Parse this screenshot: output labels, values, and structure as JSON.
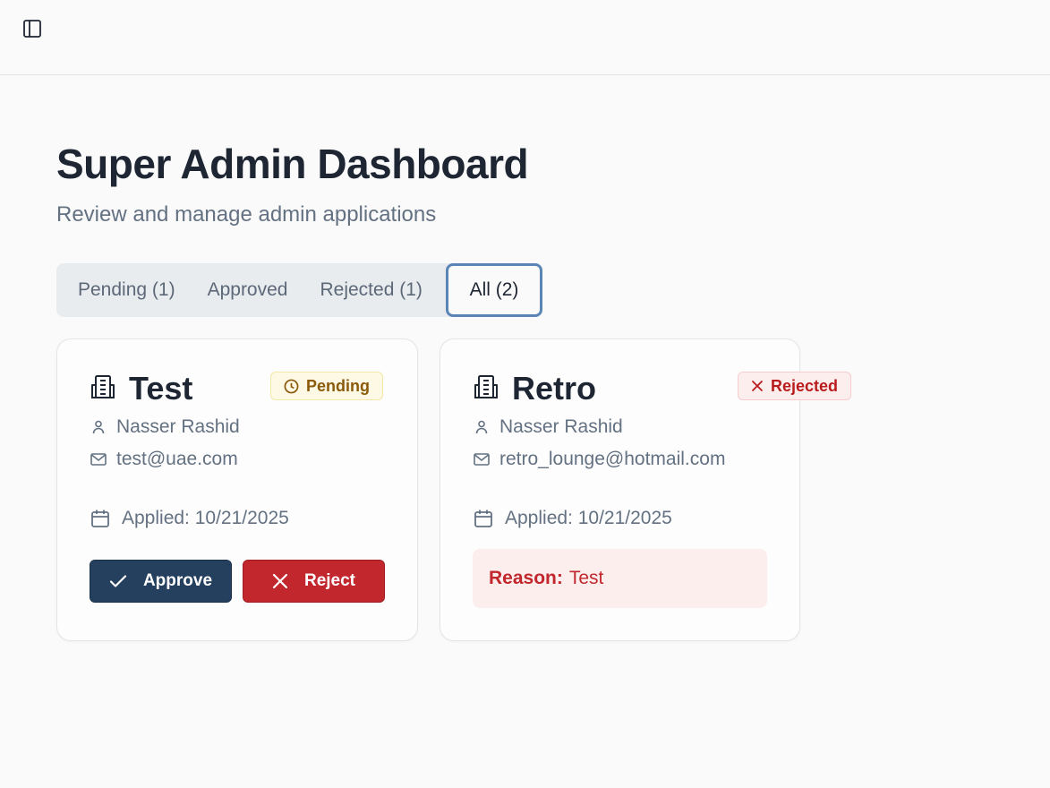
{
  "header": {
    "toggle_icon": "sidebar-panel-icon"
  },
  "page": {
    "title": "Super Admin Dashboard",
    "subtitle": "Review and manage admin applications"
  },
  "tabs": [
    {
      "label": "Pending (1)",
      "active": false
    },
    {
      "label": "Approved",
      "active": false
    },
    {
      "label": "Rejected (1)",
      "active": false
    },
    {
      "label": "All (2)",
      "active": true
    }
  ],
  "applications": [
    {
      "name": "Test",
      "status": "Pending",
      "applicant": "Nasser Rashid",
      "email": "test@uae.com",
      "applied": "Applied: 10/21/2025",
      "actions": {
        "approve": "Approve",
        "reject": "Reject"
      }
    },
    {
      "name": "Retro",
      "status": "Rejected",
      "applicant": "Nasser Rashid",
      "email": "retro_lounge@hotmail.com",
      "applied": "Applied: 10/21/2025",
      "reason_label": "Reason:",
      "reason": "Test"
    }
  ],
  "colors": {
    "primary": "#25405f",
    "danger": "#c1272d",
    "pending": "#8a5a0b",
    "tab_focus": "#5a86b6"
  }
}
